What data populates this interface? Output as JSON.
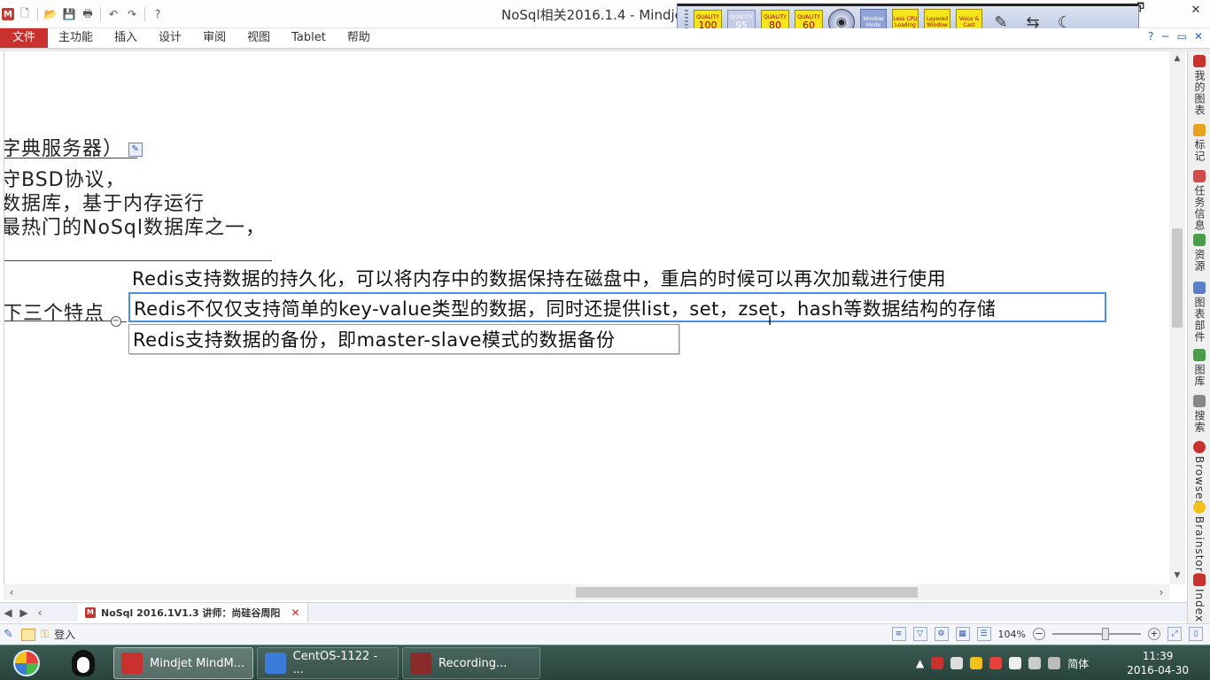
{
  "window": {
    "title": "NoSql相关2016.1.4 - Mindjet",
    "app_logo": "M",
    "controls": {
      "restore": "🗗",
      "minimize": "",
      "close": "✕"
    }
  },
  "quick_access": [
    "new-file-icon",
    "open-folder-icon",
    "save-icon",
    "print-icon",
    "undo-icon",
    "redo-icon",
    "help-icon"
  ],
  "recorder_toolbar": {
    "quality_buttons": [
      {
        "top": "QUALITY",
        "value": "100"
      },
      {
        "top": "QUALITY",
        "value": "95"
      },
      {
        "top": "QUALITY",
        "value": "80"
      },
      {
        "top": "QUALITY",
        "value": "60"
      }
    ],
    "mode_buttons": [
      {
        "label": "Window Mode"
      },
      {
        "label": "Less CPU Loading"
      },
      {
        "label": "Layered Window"
      },
      {
        "label": "Voice & Cast"
      }
    ]
  },
  "menu": {
    "items": [
      "文件",
      "主功能",
      "插入",
      "设计",
      "审阅",
      "视图",
      "Tablet",
      "帮助"
    ]
  },
  "canvas": {
    "left_topics": [
      "字典服务器）",
      "守BSD协议，",
      "数据库，基于内存运行",
      "最热门的NoSql数据库之一，"
    ],
    "branch_label": "下三个特点",
    "subtopics": [
      "Redis支持数据的持久化，可以将内存中的数据保持在磁盘中，重启的时候可以再次加载进行使用",
      "Redis不仅仅支持简单的key-value类型的数据，同时还提供list，set，zset，hash等数据结构的存储",
      "Redis支持数据的备份，即master-slave模式的数据备份"
    ],
    "collapse_symbol": "−"
  },
  "sidebar": {
    "items": [
      "我的图表",
      "标记",
      "任务信息",
      "资源",
      "图表部件",
      "图库",
      "搜索",
      "Browser",
      "Brainstorm",
      "Index"
    ]
  },
  "doc_tab": {
    "label": "NoSql 2016.1V1.3 讲师：尚硅谷周阳",
    "close": "✕"
  },
  "status": {
    "login": "登入",
    "zoom": "104%"
  },
  "taskbar": {
    "tasks": [
      {
        "label": "Mindjet MindM..."
      },
      {
        "label": "CentOS-1122 - ..."
      },
      {
        "label": "Recording..."
      }
    ],
    "ime": "简体",
    "time": "11:39",
    "date": "2016-04-30"
  }
}
